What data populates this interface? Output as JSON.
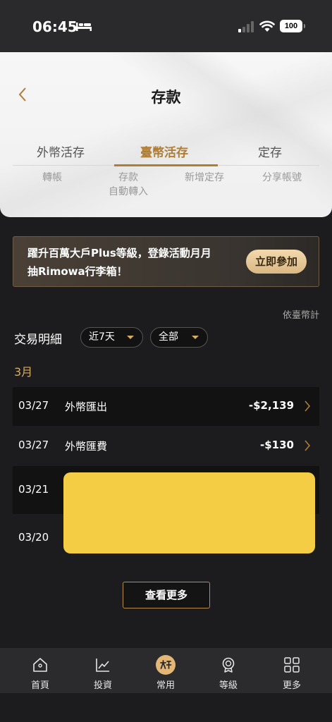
{
  "status_bar": {
    "time": "06:45",
    "battery": "100"
  },
  "header": {
    "title": "存款",
    "tabs": [
      {
        "label": "外幣活存",
        "active": false
      },
      {
        "label": "臺幣活存",
        "active": true
      },
      {
        "label": "定存",
        "active": false
      }
    ],
    "sub_tabs": [
      {
        "label": "轉帳"
      },
      {
        "label": "存款\n自動轉入"
      },
      {
        "label": "新增定存"
      },
      {
        "label": "分享帳號"
      }
    ]
  },
  "promo": {
    "line1": "躍升百萬大戶Plus等級，登錄活動月月",
    "line2": "抽Rimowa行李箱！",
    "button": "立即參加"
  },
  "currency_note": "依臺幣計",
  "transactions": {
    "title": "交易明細",
    "period_filter": "近7天",
    "type_filter": "全部",
    "month": "3月",
    "rows": [
      {
        "date": "03/27",
        "desc": "外幣匯出",
        "amount": "-$2,139"
      },
      {
        "date": "03/27",
        "desc": "外幣匯費",
        "amount": "-$130"
      },
      {
        "date": "03/21",
        "desc": "",
        "amount": ""
      },
      {
        "date": "03/20",
        "desc": "",
        "amount": ""
      }
    ],
    "more_button": "查看更多"
  },
  "bottom_nav": [
    {
      "label": "首頁",
      "icon": "home-icon"
    },
    {
      "label": "投資",
      "icon": "chart-icon"
    },
    {
      "label": "常用",
      "icon": "favorites-icon"
    },
    {
      "label": "等級",
      "icon": "medal-icon"
    },
    {
      "label": "更多",
      "icon": "grid-icon"
    }
  ],
  "colors": {
    "accent": "#b07d34",
    "gold_text": "#d8ad63",
    "redaction": "#f5cd45"
  }
}
